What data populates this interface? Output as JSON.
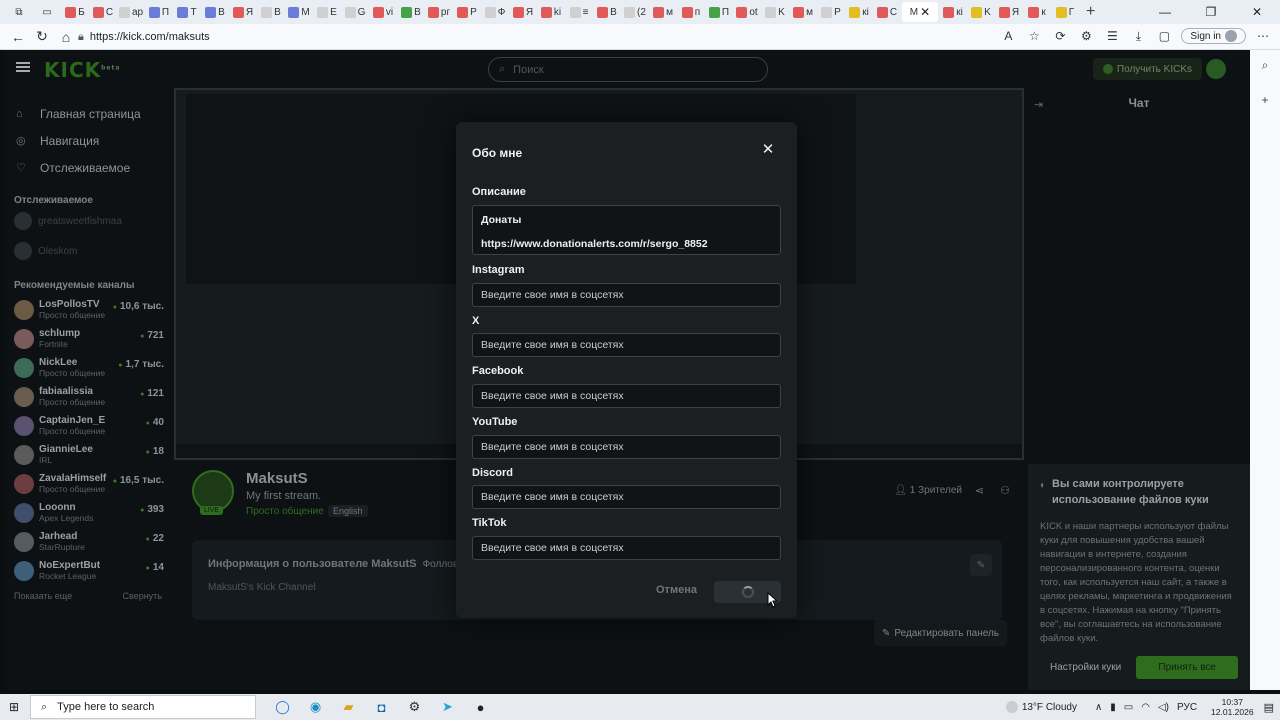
{
  "browser": {
    "url": "https://kick.com/maksuts",
    "signin_label": "Sign in",
    "tabs": [
      {
        "color": "#e05a5a",
        "label": "Б"
      },
      {
        "color": "#e05a5a",
        "label": "С"
      },
      {
        "color": "#d0d0d0",
        "label": "ар"
      },
      {
        "color": "#6a7bd8",
        "label": "П"
      },
      {
        "color": "#6a7bd8",
        "label": "Т"
      },
      {
        "color": "#6a7bd8",
        "label": "В"
      },
      {
        "color": "#e05a5a",
        "label": "Я"
      },
      {
        "color": "#d0d0d0",
        "label": "В"
      },
      {
        "color": "#6a7bd8",
        "label": "М"
      },
      {
        "color": "#d0d0d0",
        "label": "Е"
      },
      {
        "color": "#d0d0d0",
        "label": "G"
      },
      {
        "color": "#e05a5a",
        "label": "vi"
      },
      {
        "color": "#47a04a",
        "label": "В"
      },
      {
        "color": "#e05a5a",
        "label": "рг"
      },
      {
        "color": "#e05a5a",
        "label": "Р"
      },
      {
        "color": "#d0d0d0",
        "label": "Ф"
      },
      {
        "color": "#e05a5a",
        "label": "Я"
      },
      {
        "color": "#e05a5a",
        "label": "ki"
      },
      {
        "color": "#d0d0d0",
        "label": "≡"
      },
      {
        "color": "#e05a5a",
        "label": "В"
      },
      {
        "color": "#d0d0d0",
        "label": "(2"
      },
      {
        "color": "#e05a5a",
        "label": "м"
      },
      {
        "color": "#e05a5a",
        "label": "п"
      },
      {
        "color": "#47a04a",
        "label": "П"
      },
      {
        "color": "#e05a5a",
        "label": "ot"
      },
      {
        "color": "#d0d0d0",
        "label": "K"
      },
      {
        "color": "#e05a5a",
        "label": "м"
      },
      {
        "color": "#d0d0d0",
        "label": "Р"
      },
      {
        "color": "#e0c020",
        "label": "кі"
      },
      {
        "color": "#e05a5a",
        "label": "С"
      }
    ],
    "active_tab": {
      "label": "М",
      "close": "✕"
    },
    "tabs_after": [
      {
        "color": "#e05a5a",
        "label": "кі"
      },
      {
        "color": "#e0c020",
        "label": "K"
      },
      {
        "color": "#e05a5a",
        "label": "Я"
      },
      {
        "color": "#e05a5a",
        "label": "к"
      },
      {
        "color": "#e0c020",
        "label": "Г"
      }
    ]
  },
  "kick": {
    "logo": "KICK",
    "logo_sup": "beta",
    "search_placeholder": "Поиск",
    "get_kicks": "Получить KICKs",
    "nav": [
      {
        "icon": "home-icon",
        "glyph": "⌂",
        "label": "Главная страница"
      },
      {
        "icon": "compass-icon",
        "glyph": "◎",
        "label": "Навигация"
      },
      {
        "icon": "heart-icon",
        "glyph": "♡",
        "label": "Отслеживаемое"
      }
    ],
    "followed_title": "Отслеживаемое",
    "followed": [
      {
        "name": "greatsweetfishmaa"
      },
      {
        "name": "Oleskom"
      }
    ],
    "recommended_title": "Рекомендуемые каналы",
    "recommended": [
      {
        "name": "LosPollosTV",
        "sub": "Просто общение",
        "viewers": "10,6 тыс.",
        "color": "#6b5a44"
      },
      {
        "name": "schlump",
        "sub": "Fortnite",
        "viewers": "721",
        "color": "#7a5b5b"
      },
      {
        "name": "NickLee",
        "sub": "Просто общение",
        "viewers": "1,7 тыс.",
        "color": "#3d6b5a"
      },
      {
        "name": "fabiaalissia",
        "sub": "Просто общение",
        "viewers": "121",
        "color": "#6a5d4e"
      },
      {
        "name": "CaptainJen_E",
        "sub": "Просто общение",
        "viewers": "40",
        "color": "#5a5270"
      },
      {
        "name": "GiannieLee",
        "sub": "IRL",
        "viewers": "18",
        "color": "#5b5b5b"
      },
      {
        "name": "ZavalaHimself",
        "sub": "Просто общение",
        "viewers": "16,5 тыс.",
        "color": "#6b3f3f"
      },
      {
        "name": "Looonn",
        "sub": "Apex Legends",
        "viewers": "393",
        "color": "#3f4f6b"
      },
      {
        "name": "Jarhead",
        "sub": "StarRupture",
        "viewers": "22",
        "color": "#555b60"
      },
      {
        "name": "NoExpertBut",
        "sub": "Rocket League",
        "viewers": "14",
        "color": "#3e5f7a"
      }
    ],
    "show_more": "Показать еще",
    "collapse": "Свернуть",
    "chat_title": "Чат",
    "streamer": {
      "name": "MaksutS",
      "title": "My first stream.",
      "category": "Просто общение",
      "tag": "English",
      "live": "LIVE",
      "viewers": "1 Зрителей"
    },
    "about": {
      "title": "Информация о пользователе MaksutS",
      "followers": "Фолловеры",
      "text": "MaksutS's Kick Channel"
    },
    "edit_panel": "Редактировать панель",
    "cookie": {
      "title": "Вы сами контролируете использование файлов куки",
      "body": "KICK и наши партнеры используют файлы куки для повышения удобства вашей навигации в интернете, создания персонализированного контента, оценки того, как используется наш сайт, а также в целях рекламы, маркетинга и продвижения в соцсетях. Нажимая на кнопку \"Принять все\", вы соглашаетесь на использование файлов куки.",
      "settings": "Настройки куки",
      "accept": "Принять все"
    }
  },
  "modal": {
    "title": "Обо мне",
    "description_label": "Описание",
    "description_lines": [
      "Донаты",
      "https://www.donationalerts.com/r/sergo_8852"
    ],
    "fields": [
      {
        "label": "Instagram",
        "placeholder": "Введите свое имя в соцсетях"
      },
      {
        "label": "X",
        "placeholder": "Введите свое имя в соцсетях"
      },
      {
        "label": "Facebook",
        "placeholder": "Введите свое имя в соцсетях"
      },
      {
        "label": "YouTube",
        "placeholder": "Введите свое имя в соцсетях"
      },
      {
        "label": "Discord",
        "placeholder": "Введите свое имя в соцсетях"
      },
      {
        "label": "TikTok",
        "placeholder": "Введите свое имя в соцсетях"
      }
    ],
    "cancel": "Отмена"
  },
  "taskbar": {
    "search_placeholder": "Type here to search",
    "weather": "13°F  Cloudy",
    "lang": "РУС",
    "time": "10:37",
    "date": "12.01.2026"
  }
}
